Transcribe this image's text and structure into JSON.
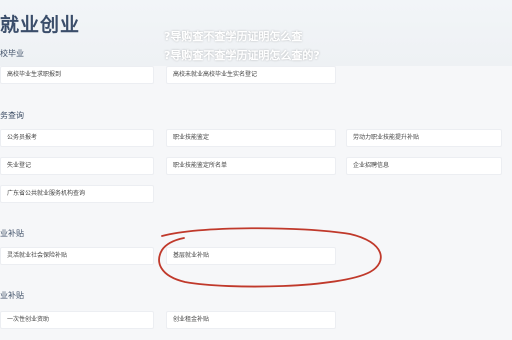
{
  "header": {
    "title": "就业创业",
    "overlay_lines": [
      "?导购查不查学历证明怎么查",
      "?导购查不查学历证明怎么查的?"
    ]
  },
  "sections": [
    {
      "title": "校毕业",
      "items": [
        "高校毕业生求职报到",
        "高校未就业高校毕业生实名登记"
      ]
    },
    {
      "title": "务查询",
      "items": [
        "公务员报考",
        "职业技能鉴定",
        "劳动力职业技能提升补贴",
        "失业登记",
        "职业技能鉴定所名单",
        "企业招聘信息",
        "广东省公共就业服务机构查询"
      ]
    },
    {
      "title": "业补贴",
      "items": [
        "灵活就业社会保险补贴",
        "基层就业补贴"
      ]
    },
    {
      "title": "业补贴",
      "items": [
        "一次性创业资助",
        "创业租金补贴"
      ]
    }
  ],
  "colors": {
    "accent": "#c0392b",
    "banner_text": "#ffffff",
    "section_title": "#3d4e66"
  }
}
